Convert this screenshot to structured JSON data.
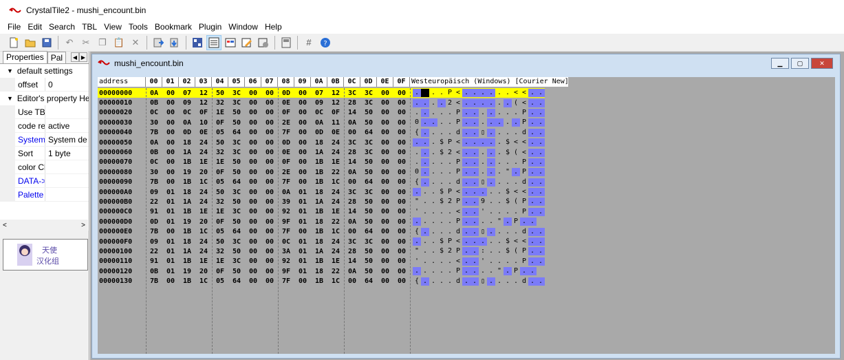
{
  "window": {
    "title": "CrystalTile2 - mushi_encount.bin"
  },
  "menu": [
    "File",
    "Edit",
    "Search",
    "TBL",
    "View",
    "Tools",
    "Bookmark",
    "Plugin",
    "Window",
    "Help"
  ],
  "toolbar": {
    "icons": [
      "new-file-icon",
      "open-folder-icon",
      "save-icon",
      "undo-icon",
      "cut-icon",
      "copy-icon",
      "paste-icon",
      "delete-icon",
      "import-icon",
      "export-icon",
      "tile-viewer-icon",
      "hex-viewer-icon",
      "palette-icon",
      "edit-icon",
      "settings-icon",
      "bookmark-icon",
      "grid-icon",
      "help-icon"
    ]
  },
  "left_panel": {
    "tabs": [
      "Properties",
      "Pal"
    ],
    "sections": [
      {
        "title": "default settings",
        "rows": [
          {
            "name": "offset",
            "value": "0"
          }
        ]
      },
      {
        "title": "Editor's property He",
        "rows": [
          {
            "name": "Use TBL",
            "value": ""
          },
          {
            "name": "code re",
            "value": "active"
          },
          {
            "name": "System I",
            "value": "System def"
          },
          {
            "name": "Sort",
            "value": "1 byte"
          },
          {
            "name": "color Cl",
            "value": ""
          },
          {
            "name": "DATA->I",
            "value": ""
          },
          {
            "name": "Palette -",
            "value": ""
          }
        ]
      }
    ],
    "logo_text": "天使汉化组"
  },
  "child_window": {
    "title": "mushi_encount.bin"
  },
  "hex": {
    "address_label": "address",
    "columns": [
      "00",
      "01",
      "02",
      "03",
      "04",
      "05",
      "06",
      "07",
      "08",
      "09",
      "0A",
      "0B",
      "0C",
      "0D",
      "0E",
      "0F"
    ],
    "encoding_label": "Westeuropäisch (Windows) [Courier New]",
    "rows": [
      {
        "addr": "00000000",
        "bytes": "0A 00 07 12 50 3C 00 00 0D 00 07 12 3C 3C 00 00",
        "text": "▮▮..P<▮▮▮▮..<<▮▮"
      },
      {
        "addr": "00000010",
        "bytes": "0B 00 09 12 32 3C 00 00 0E 00 09 12 28 3C 00 00",
        "text": "▮▮.▮2<▮▮▮▮.▮(<▮▮"
      },
      {
        "addr": "00000020",
        "bytes": "0C 00 0C 0F 1E 50 00 00 0F 00 0C 0F 14 50 00 00",
        "text": ".▮...P▮▮.▮...P▮▮"
      },
      {
        "addr": "00000030",
        "bytes": "30 00 0A 10 0F 50 00 00 2E 00 0A 11 0A 50 00 00",
        "text": "0▮▮..P▮▮.▮▮.▮P▮▮"
      },
      {
        "addr": "00000040",
        "bytes": "7B 00 0D 0E 05 64 00 00 7F 00 0D 0E 00 64 00 00",
        "text": "{▮...d▮▮▯▮...d▮▮"
      },
      {
        "addr": "00000050",
        "bytes": "0A 00 18 24 50 3C 00 00 0D 00 18 24 3C 3C 00 00",
        "text": "▮▮.$P<▮▮▮▮.$<<▮▮"
      },
      {
        "addr": "00000060",
        "bytes": "0B 00 1A 24 32 3C 00 00 0E 00 1A 24 28 3C 00 00",
        "text": ".▮.$2<▮▮.▮.$(<▮▮"
      },
      {
        "addr": "00000070",
        "bytes": "0C 00 1B 1E 1E 50 00 00 0F 00 1B 1E 14 50 00 00",
        "text": ".▮...P▮▮.▮...P▮▮"
      },
      {
        "addr": "00000080",
        "bytes": "30 00 19 20 0F 50 00 00 2E 00 1B 22 0A 50 00 00",
        "text": "0▮...P▮▮.▮.\"▮P▮▮"
      },
      {
        "addr": "00000090",
        "bytes": "7B 00 1B 1C 05 64 00 00 7F 00 1B 1C 00 64 00 00",
        "text": "{▮...d▮▮▯▮...d▮▮"
      },
      {
        "addr": "000000A0",
        "bytes": "09 01 18 24 50 3C 00 00 0A 01 18 24 3C 3C 00 00",
        "text": "▮..$P<▮▮▮..$<<▮▮"
      },
      {
        "addr": "000000B0",
        "bytes": "22 01 1A 24 32 50 00 00 39 01 1A 24 28 50 00 00",
        "text": "\"..$2P▮▮9..$(P▮▮"
      },
      {
        "addr": "000000C0",
        "bytes": "91 01 1B 1E 1E 3C 00 00 92 01 1B 1E 14 50 00 00",
        "text": "'....<▮▮'....P▮▮"
      },
      {
        "addr": "000000D0",
        "bytes": "0D 01 19 20 0F 50 00 00 9F 01 18 22 0A 50 00 00",
        "text": "▮....P▮▮..\"▮P▮▮"
      },
      {
        "addr": "000000E0",
        "bytes": "7B 00 1B 1C 05 64 00 00 7F 00 1B 1C 00 64 00 00",
        "text": "{▮...d▮▮▯▮...d▮▮"
      },
      {
        "addr": "000000F0",
        "bytes": "09 01 18 24 50 3C 00 00 0C 01 18 24 3C 3C 00 00",
        "text": "▮..$P<▮▮▮..$<<▮▮"
      },
      {
        "addr": "00000100",
        "bytes": "22 01 1A 24 32 50 00 00 3A 01 1A 24 28 50 00 00",
        "text": "\"..$2P▮▮:..$(P▮▮"
      },
      {
        "addr": "00000110",
        "bytes": "91 01 1B 1E 1E 3C 00 00 92 01 1B 1E 14 50 00 00",
        "text": "'....<▮▮'....P▮▮"
      },
      {
        "addr": "00000120",
        "bytes": "0B 01 19 20 0F 50 00 00 9F 01 18 22 0A 50 00 00",
        "text": "▮....P▮▮..\"▮P▮▮"
      },
      {
        "addr": "00000130",
        "bytes": "7B 00 1B 1C 05 64 00 00 7F 00 1B 1C 00 64 00 00",
        "text": "{▮...d▮▮▯▮...d▮▮"
      }
    ],
    "selected_row": 0
  }
}
